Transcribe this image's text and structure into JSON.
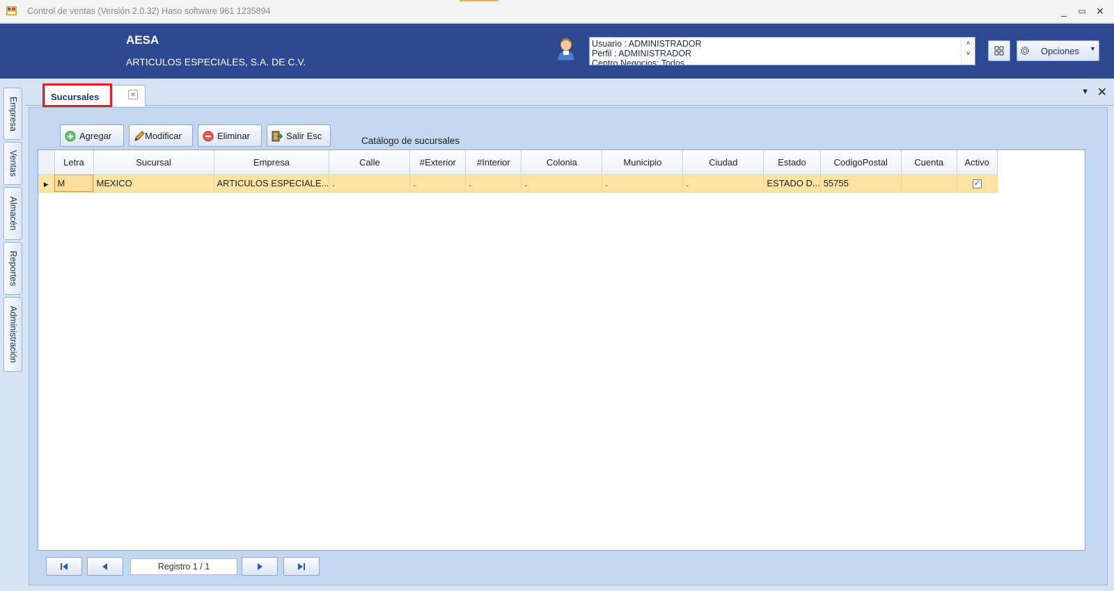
{
  "window": {
    "title": "Control de ventas  (Versión 2.0.32)  Haso software  961 1235894",
    "minimize": "_",
    "restore": "▭",
    "close": "✕"
  },
  "header": {
    "company_short": "AESA",
    "company_long": "ARTICULOS ESPECIALES, S.A. DE C.V.",
    "user_lines": [
      "Usuario : ADMINISTRADOR",
      "Perfil : ADMINISTRADOR",
      "Centro Negocios: Todos"
    ],
    "options_label": "Opciones",
    "scroll_up": "˄",
    "scroll_down": "˅"
  },
  "sidebar": {
    "tabs": [
      "Empresa",
      "Ventas",
      "Almacén",
      "Reportes",
      "Administración"
    ]
  },
  "document": {
    "tab_label": "Sucursales",
    "tab_close": "✕",
    "catalog_title": "Catálogo de sucursales"
  },
  "toolbar": {
    "add": "Agregar",
    "edit": "Modificar",
    "delete": "Eliminar",
    "exit": "Salir  Esc"
  },
  "grid": {
    "columns": [
      "Letra",
      "Sucursal",
      "Empresa",
      "Calle",
      "#Exterior",
      "#Interior",
      "Colonia",
      "Municipio",
      "Ciudad",
      "Estado",
      "CodigoPostal",
      "Cuenta",
      "Activo"
    ],
    "rows": [
      {
        "letra": "M",
        "sucursal": "MEXICO",
        "empresa": "ARTICULOS ESPECIALE...",
        "calle": ".",
        "exterior": ".",
        "interior": ".",
        "colonia": ".",
        "municipio": ".",
        "ciudad": ".",
        "estado": "ESTADO D...",
        "codigo_postal": "55755",
        "cuenta": "",
        "activo_mark": "✓"
      }
    ]
  },
  "navigator": {
    "record_text": "Registro  1 / 1"
  },
  "colors": {
    "header_bg": "#2c4992",
    "selected_row": "#fde4a6",
    "highlight_box": "#e02020"
  }
}
